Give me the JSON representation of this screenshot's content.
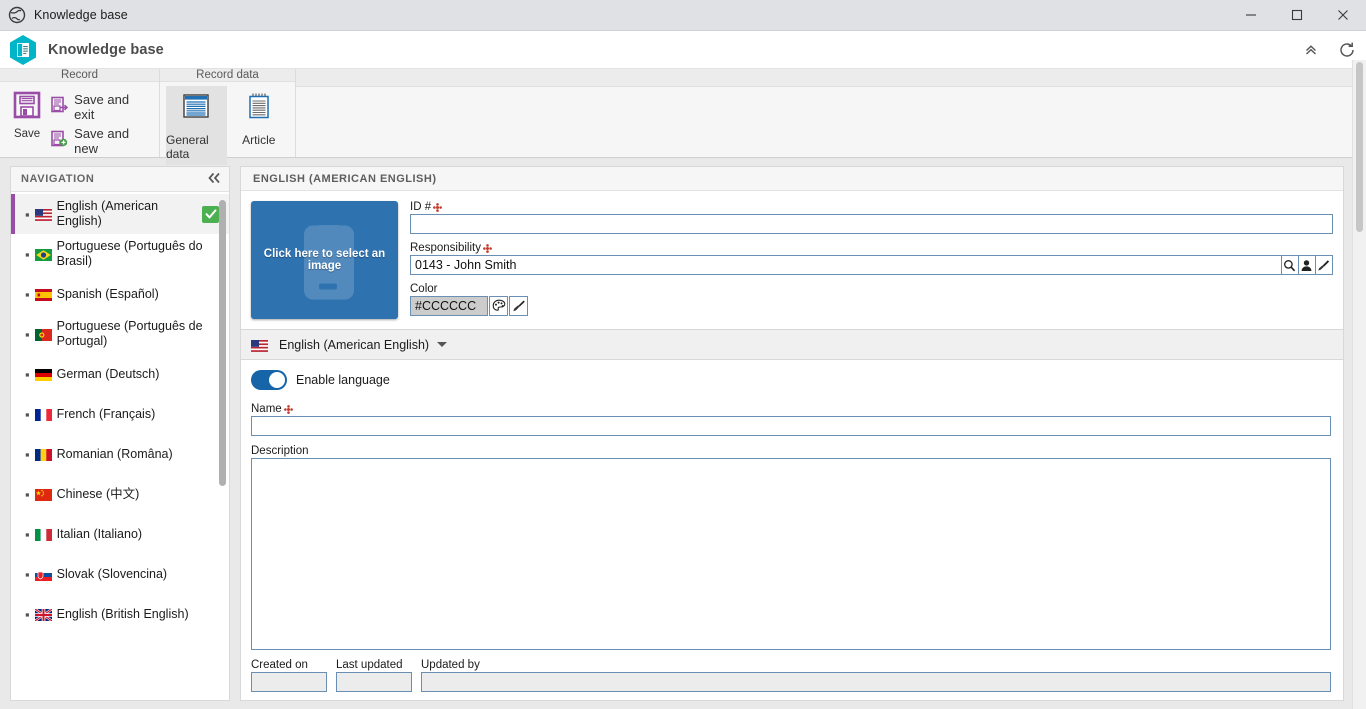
{
  "window": {
    "title": "Knowledge base",
    "icon": "globe-icon",
    "minimize_label": "—",
    "maximize_label": "□",
    "close_label": "✕"
  },
  "app_header": {
    "title": "Knowledge base",
    "icon": "knowledge-base-hexagon-icon",
    "collapse_ribbon_label": "«",
    "refresh_label": "⟳"
  },
  "ribbon": {
    "groups": [
      {
        "label": "Record",
        "big_button": {
          "label": "Save",
          "icon": "floppy-disk-icon"
        },
        "small_buttons": [
          {
            "label": "Save and exit",
            "icon": "save-exit-icon"
          },
          {
            "label": "Save and new",
            "icon": "save-new-icon"
          }
        ]
      },
      {
        "label": "Record data",
        "tabs": [
          {
            "label": "General data",
            "icon": "document-lines-icon",
            "active": true
          },
          {
            "label": "Article",
            "icon": "notepad-icon",
            "active": false
          }
        ]
      }
    ]
  },
  "sidebar": {
    "header": "NAVIGATION",
    "collapse_icon": "double-chevron-left-icon",
    "items": [
      {
        "label": "English (American English)",
        "flag": "us",
        "selected": true,
        "checked": true
      },
      {
        "label": "Portuguese (Português do Brasil)",
        "flag": "br",
        "selected": false,
        "checked": false
      },
      {
        "label": "Spanish (Español)",
        "flag": "es",
        "selected": false,
        "checked": false
      },
      {
        "label": "Portuguese (Português de Portugal)",
        "flag": "pt",
        "selected": false,
        "checked": false
      },
      {
        "label": "German (Deutsch)",
        "flag": "de",
        "selected": false,
        "checked": false
      },
      {
        "label": "French (Français)",
        "flag": "fr",
        "selected": false,
        "checked": false
      },
      {
        "label": "Romanian (Româna)",
        "flag": "ro",
        "selected": false,
        "checked": false
      },
      {
        "label": "Chinese (中文)",
        "flag": "cn",
        "selected": false,
        "checked": false
      },
      {
        "label": "Italian (Italiano)",
        "flag": "it",
        "selected": false,
        "checked": false
      },
      {
        "label": "Slovak (Slovencina)",
        "flag": "sk",
        "selected": false,
        "checked": false
      },
      {
        "label": "English (British English)",
        "flag": "gb",
        "selected": false,
        "checked": false
      }
    ]
  },
  "main": {
    "panel_title": "ENGLISH (AMERICAN ENGLISH)",
    "image_picker": {
      "text": "Click here to select an image",
      "background_color": "#2F72B0"
    },
    "id_field": {
      "label": "ID #",
      "value": "",
      "required": true
    },
    "responsibility_field": {
      "label": "Responsibility",
      "value": "0143 - John Smith",
      "required": true,
      "buttons": [
        {
          "icon": "magnifier-icon"
        },
        {
          "icon": "person-icon"
        },
        {
          "icon": "eraser-icon"
        }
      ]
    },
    "color_field": {
      "label": "Color",
      "value": "#CCCCCC",
      "swatch_color": "#CCCCCC",
      "buttons": [
        {
          "icon": "palette-icon"
        },
        {
          "icon": "brush-icon"
        }
      ]
    },
    "language_selector": {
      "label": "English (American English)",
      "flag": "us",
      "caret": "chevron-down-icon"
    },
    "enable_language": {
      "label": "Enable language",
      "enabled": true
    },
    "name_field": {
      "label": "Name",
      "value": "",
      "required": true
    },
    "description_field": {
      "label": "Description",
      "value": ""
    },
    "created_on": {
      "label": "Created on",
      "value": "",
      "readonly": true
    },
    "last_updated": {
      "label": "Last updated",
      "value": "",
      "readonly": true
    },
    "updated_by": {
      "label": "Updated by",
      "value": "",
      "readonly": true
    }
  },
  "colors": {
    "accent_purple": "#9A4DA6",
    "accent_blue": "#2F72B0",
    "toggle_on": "#1565A8",
    "check_green": "#4CAF50"
  }
}
